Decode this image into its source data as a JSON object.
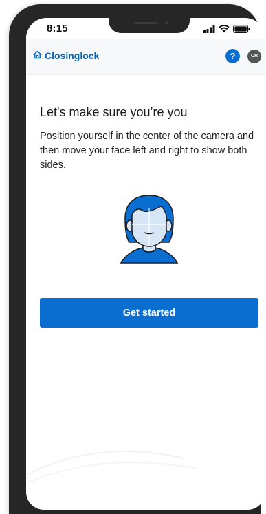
{
  "status_bar": {
    "time": "8:15",
    "icons": [
      "cellular-signal-icon",
      "wifi-icon",
      "battery-icon"
    ]
  },
  "header": {
    "brand": "Closinglock",
    "brand_icon": "home-icon",
    "help_label": "?",
    "avatar_initials": "CR"
  },
  "main": {
    "title": "Let's make sure you’re you",
    "description": "Position yourself in the center of the camera and then move your face left and right to show both sides.",
    "illustration": "face-outline-illustration",
    "cta_label": "Get started"
  },
  "colors": {
    "accent": "#0a6ed1",
    "brand_text": "#0067c0",
    "header_bg": "#f7f8f9",
    "face_fill": "#d6e6f6",
    "hair_fill": "#0a6ed1",
    "frame": "#262626",
    "avatar_bg": "#555555"
  }
}
